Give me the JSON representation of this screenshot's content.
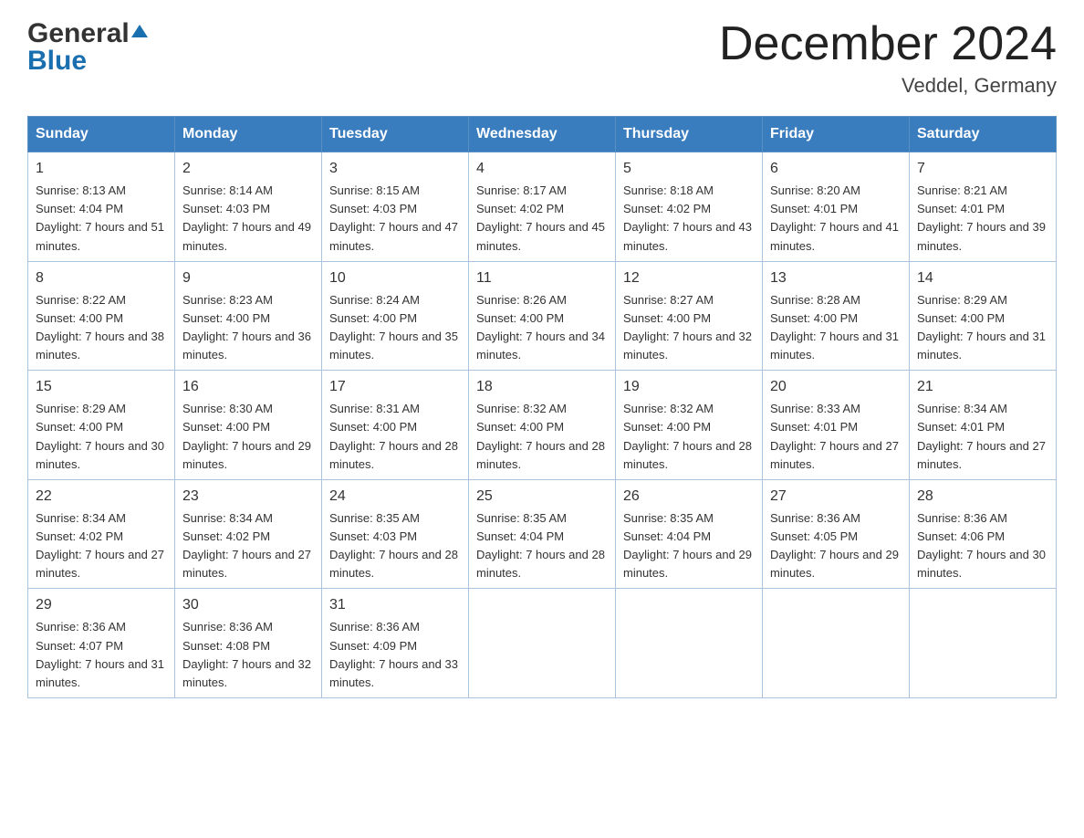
{
  "header": {
    "logo_general": "General",
    "logo_blue": "Blue",
    "month_title": "December 2024",
    "location": "Veddel, Germany"
  },
  "weekdays": [
    "Sunday",
    "Monday",
    "Tuesday",
    "Wednesday",
    "Thursday",
    "Friday",
    "Saturday"
  ],
  "weeks": [
    [
      {
        "day": "1",
        "sunrise": "8:13 AM",
        "sunset": "4:04 PM",
        "daylight": "7 hours and 51 minutes."
      },
      {
        "day": "2",
        "sunrise": "8:14 AM",
        "sunset": "4:03 PM",
        "daylight": "7 hours and 49 minutes."
      },
      {
        "day": "3",
        "sunrise": "8:15 AM",
        "sunset": "4:03 PM",
        "daylight": "7 hours and 47 minutes."
      },
      {
        "day": "4",
        "sunrise": "8:17 AM",
        "sunset": "4:02 PM",
        "daylight": "7 hours and 45 minutes."
      },
      {
        "day": "5",
        "sunrise": "8:18 AM",
        "sunset": "4:02 PM",
        "daylight": "7 hours and 43 minutes."
      },
      {
        "day": "6",
        "sunrise": "8:20 AM",
        "sunset": "4:01 PM",
        "daylight": "7 hours and 41 minutes."
      },
      {
        "day": "7",
        "sunrise": "8:21 AM",
        "sunset": "4:01 PM",
        "daylight": "7 hours and 39 minutes."
      }
    ],
    [
      {
        "day": "8",
        "sunrise": "8:22 AM",
        "sunset": "4:00 PM",
        "daylight": "7 hours and 38 minutes."
      },
      {
        "day": "9",
        "sunrise": "8:23 AM",
        "sunset": "4:00 PM",
        "daylight": "7 hours and 36 minutes."
      },
      {
        "day": "10",
        "sunrise": "8:24 AM",
        "sunset": "4:00 PM",
        "daylight": "7 hours and 35 minutes."
      },
      {
        "day": "11",
        "sunrise": "8:26 AM",
        "sunset": "4:00 PM",
        "daylight": "7 hours and 34 minutes."
      },
      {
        "day": "12",
        "sunrise": "8:27 AM",
        "sunset": "4:00 PM",
        "daylight": "7 hours and 32 minutes."
      },
      {
        "day": "13",
        "sunrise": "8:28 AM",
        "sunset": "4:00 PM",
        "daylight": "7 hours and 31 minutes."
      },
      {
        "day": "14",
        "sunrise": "8:29 AM",
        "sunset": "4:00 PM",
        "daylight": "7 hours and 31 minutes."
      }
    ],
    [
      {
        "day": "15",
        "sunrise": "8:29 AM",
        "sunset": "4:00 PM",
        "daylight": "7 hours and 30 minutes."
      },
      {
        "day": "16",
        "sunrise": "8:30 AM",
        "sunset": "4:00 PM",
        "daylight": "7 hours and 29 minutes."
      },
      {
        "day": "17",
        "sunrise": "8:31 AM",
        "sunset": "4:00 PM",
        "daylight": "7 hours and 28 minutes."
      },
      {
        "day": "18",
        "sunrise": "8:32 AM",
        "sunset": "4:00 PM",
        "daylight": "7 hours and 28 minutes."
      },
      {
        "day": "19",
        "sunrise": "8:32 AM",
        "sunset": "4:00 PM",
        "daylight": "7 hours and 28 minutes."
      },
      {
        "day": "20",
        "sunrise": "8:33 AM",
        "sunset": "4:01 PM",
        "daylight": "7 hours and 27 minutes."
      },
      {
        "day": "21",
        "sunrise": "8:34 AM",
        "sunset": "4:01 PM",
        "daylight": "7 hours and 27 minutes."
      }
    ],
    [
      {
        "day": "22",
        "sunrise": "8:34 AM",
        "sunset": "4:02 PM",
        "daylight": "7 hours and 27 minutes."
      },
      {
        "day": "23",
        "sunrise": "8:34 AM",
        "sunset": "4:02 PM",
        "daylight": "7 hours and 27 minutes."
      },
      {
        "day": "24",
        "sunrise": "8:35 AM",
        "sunset": "4:03 PM",
        "daylight": "7 hours and 28 minutes."
      },
      {
        "day": "25",
        "sunrise": "8:35 AM",
        "sunset": "4:04 PM",
        "daylight": "7 hours and 28 minutes."
      },
      {
        "day": "26",
        "sunrise": "8:35 AM",
        "sunset": "4:04 PM",
        "daylight": "7 hours and 29 minutes."
      },
      {
        "day": "27",
        "sunrise": "8:36 AM",
        "sunset": "4:05 PM",
        "daylight": "7 hours and 29 minutes."
      },
      {
        "day": "28",
        "sunrise": "8:36 AM",
        "sunset": "4:06 PM",
        "daylight": "7 hours and 30 minutes."
      }
    ],
    [
      {
        "day": "29",
        "sunrise": "8:36 AM",
        "sunset": "4:07 PM",
        "daylight": "7 hours and 31 minutes."
      },
      {
        "day": "30",
        "sunrise": "8:36 AM",
        "sunset": "4:08 PM",
        "daylight": "7 hours and 32 minutes."
      },
      {
        "day": "31",
        "sunrise": "8:36 AM",
        "sunset": "4:09 PM",
        "daylight": "7 hours and 33 minutes."
      },
      null,
      null,
      null,
      null
    ]
  ]
}
